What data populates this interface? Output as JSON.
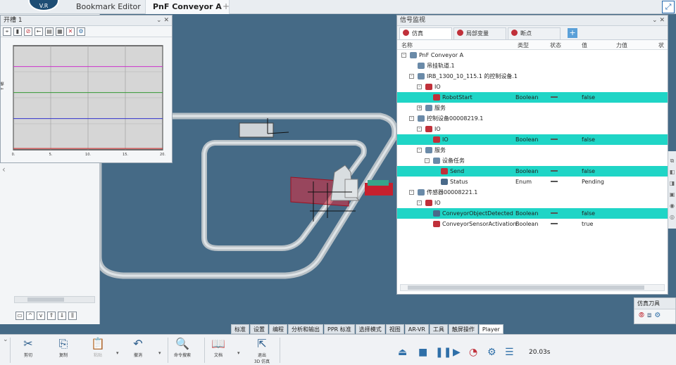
{
  "topbar": {
    "logo_text": "V.R",
    "tabs": [
      {
        "label": "Bookmark Editor"
      },
      {
        "label": "PnF Conveyor A"
      }
    ],
    "add_tab": "+"
  },
  "chart_window": {
    "title": "开槽 1",
    "close": "⌄ ✕",
    "ylabel": "Y 轴"
  },
  "chart_data": {
    "type": "line",
    "title": "",
    "xlabel": "",
    "ylabel": "Y 轴",
    "xlim": [
      0,
      20
    ],
    "ylim": [
      0,
      4
    ],
    "x_ticks": [
      "0.",
      "5.",
      "10.",
      "15.",
      "20."
    ],
    "grid": true,
    "series": [
      {
        "color": "#cc33cc",
        "values": [
          3.2,
          3.2,
          3.2,
          3.2,
          3.2
        ]
      },
      {
        "color": "#339933",
        "values": [
          2.2,
          2.2,
          2.2,
          2.2,
          2.2
        ]
      },
      {
        "color": "#3333cc",
        "values": [
          1.2,
          1.2,
          1.2,
          1.2,
          1.2
        ]
      },
      {
        "color": "#cc2222",
        "values": [
          0.05,
          0.05,
          0.05,
          0.05,
          0.05
        ]
      }
    ]
  },
  "signal_monitor": {
    "title": "信号监视",
    "tabs": [
      {
        "label": "仿真"
      },
      {
        "label": "局部变量"
      },
      {
        "label": "断点"
      }
    ],
    "add_tab": "+",
    "columns": [
      "名称",
      "类型",
      "状态",
      "值",
      "力值",
      "状"
    ],
    "rows": [
      {
        "name": "PnF Conveyor A",
        "type": "",
        "value": "",
        "indent": 0,
        "expand": "-",
        "highlight": false,
        "icon_color": "#6a8aa8"
      },
      {
        "name": "吊挂轨道.1",
        "type": "",
        "value": "",
        "indent": 1,
        "expand": "",
        "highlight": false,
        "icon_color": "#6a8aa8"
      },
      {
        "name": "IRB_1300_10_115.1 的控制设备.1",
        "type": "",
        "value": "",
        "indent": 1,
        "expand": "-",
        "highlight": false,
        "icon_color": "#6a8aa8"
      },
      {
        "name": "IO",
        "type": "",
        "value": "",
        "indent": 2,
        "expand": "-",
        "highlight": false,
        "icon_color": "#c0303a"
      },
      {
        "name": "RobotStart",
        "type": "Boolean",
        "value": "false",
        "indent": 3,
        "expand": "",
        "highlight": true,
        "icon_color": "#c0303a"
      },
      {
        "name": "服务",
        "type": "",
        "value": "",
        "indent": 2,
        "expand": "+",
        "highlight": false,
        "icon_color": "#6a8aa8"
      },
      {
        "name": "控制设备00008219.1",
        "type": "",
        "value": "",
        "indent": 1,
        "expand": "-",
        "highlight": false,
        "icon_color": "#6a8aa8"
      },
      {
        "name": "IO",
        "type": "",
        "value": "",
        "indent": 2,
        "expand": "-",
        "highlight": false,
        "icon_color": "#c0303a"
      },
      {
        "name": "IO",
        "type": "Boolean",
        "value": "false",
        "indent": 3,
        "expand": "",
        "highlight": true,
        "icon_color": "#c0303a"
      },
      {
        "name": "服务",
        "type": "",
        "value": "",
        "indent": 2,
        "expand": "-",
        "highlight": false,
        "icon_color": "#6a8aa8"
      },
      {
        "name": "设备任务",
        "type": "",
        "value": "",
        "indent": 3,
        "expand": "-",
        "highlight": false,
        "icon_color": "#6a8aa8"
      },
      {
        "name": "Send",
        "type": "Boolean",
        "value": "false",
        "indent": 4,
        "expand": "",
        "highlight": true,
        "icon_color": "#c0303a"
      },
      {
        "name": "Status",
        "type": "Enum",
        "value": "Pending",
        "indent": 4,
        "expand": "",
        "highlight": false,
        "icon_color": "#4a6a8a"
      },
      {
        "name": "传感器00008221.1",
        "type": "",
        "value": "",
        "indent": 1,
        "expand": "-",
        "highlight": false,
        "icon_color": "#6a8aa8"
      },
      {
        "name": "IO",
        "type": "",
        "value": "",
        "indent": 2,
        "expand": "-",
        "highlight": false,
        "icon_color": "#c0303a"
      },
      {
        "name": "ConveyorObjectDetected",
        "type": "Boolean",
        "value": "false",
        "indent": 3,
        "expand": "",
        "highlight": true,
        "icon_color": "#4a6a8a"
      },
      {
        "name": "ConveyorSensorActivation",
        "type": "Boolean",
        "value": "true",
        "indent": 3,
        "expand": "",
        "highlight": false,
        "icon_color": "#c0303a"
      }
    ]
  },
  "sim_tool": {
    "title": "仿真刀具"
  },
  "ribbon_tabs": [
    "标准",
    "设置",
    "编程",
    "分析和输出",
    "PPR 标准",
    "选择模式",
    "视图",
    "AR-VR",
    "工具",
    "触屏操作",
    "Player"
  ],
  "ribbon_buttons": [
    {
      "label": "剪切",
      "glyph": "✂",
      "disabled": false
    },
    {
      "label": "复制",
      "glyph": "⎘",
      "disabled": false
    },
    {
      "label": "粘贴",
      "glyph": "📋",
      "disabled": true
    },
    {
      "label": "撤消",
      "glyph": "↶",
      "disabled": false
    },
    {
      "label": "命令搜索",
      "glyph": "🔍",
      "disabled": false
    },
    {
      "label": "文档",
      "glyph": "📖",
      "disabled": false
    },
    {
      "label": "退出\n3D 仿真",
      "glyph": "⇱",
      "disabled": false
    }
  ],
  "player": {
    "time": "20.03s"
  },
  "colors": {
    "viewport_bg": "#456a86",
    "highlight": "#1fd5c6",
    "accent": "#2e6fa8"
  }
}
